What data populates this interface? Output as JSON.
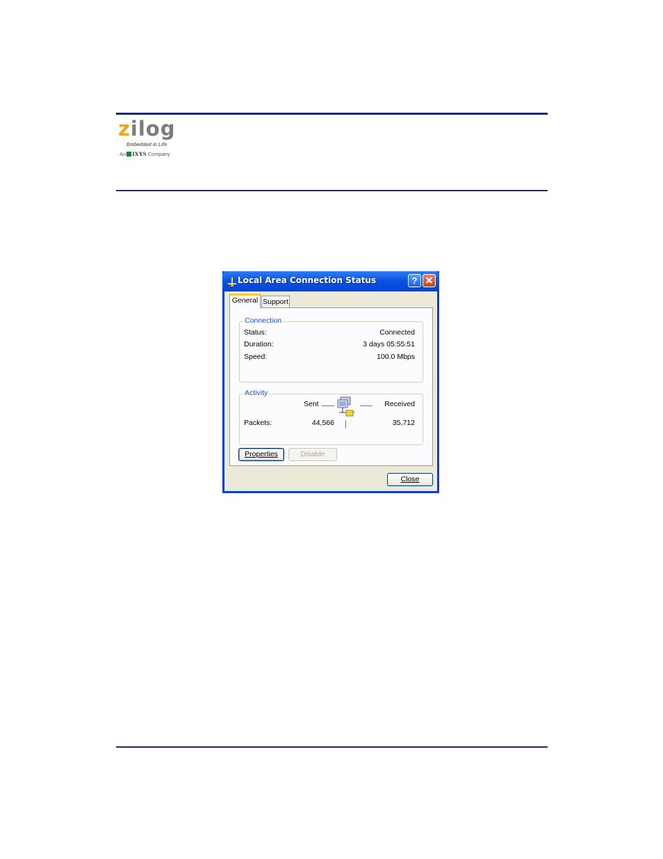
{
  "header": {
    "logo_word": "zilog",
    "logo_tagline": "Embedded in Life",
    "logo_company_prefix": "An",
    "logo_company_name": "IXYS",
    "logo_company_suffix": "Company"
  },
  "dialog": {
    "title": "Local Area Connection Status",
    "help_glyph": "?",
    "close_glyph": "✕",
    "tabs": [
      {
        "label": "General",
        "active": true
      },
      {
        "label": "Support",
        "active": false
      }
    ],
    "connection": {
      "title": "Connection",
      "rows": [
        {
          "label": "Status:",
          "value": "Connected"
        },
        {
          "label": "Duration:",
          "value": "3 days 05:55:51"
        },
        {
          "label": "Speed:",
          "value": "100.0 Mbps"
        }
      ]
    },
    "activity": {
      "title": "Activity",
      "sent_label": "Sent",
      "received_label": "Received",
      "packets_label": "Packets:",
      "packets_sent": "44,566",
      "packets_received": "35,712"
    },
    "buttons": {
      "properties": "Properties",
      "disable": "Disable",
      "close": "Close"
    }
  },
  "colors": {
    "rule": "#1f2a6b",
    "xp_title": "#0b55e0",
    "group_title": "#1550d8",
    "logo_accent": "#f0a818"
  },
  "icons": [
    "network-icon",
    "help-icon",
    "close-icon",
    "network-computers-icon"
  ]
}
